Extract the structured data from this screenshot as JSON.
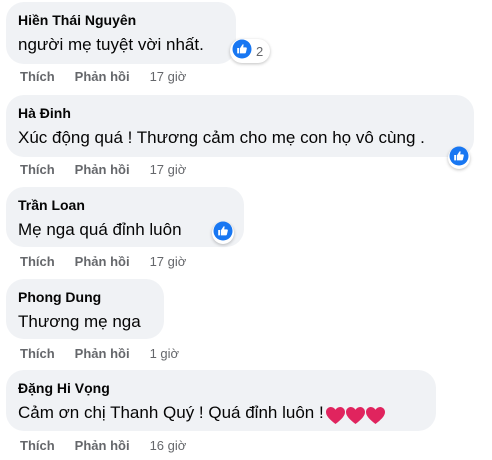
{
  "actions": {
    "like_label": "Thích",
    "reply_label": "Phản hồi"
  },
  "comments": [
    {
      "author": "Hiền Thái Nguyên",
      "text": "người mẹ tuyệt vời nhất.",
      "reaction": "like-icon",
      "reaction_count": "2",
      "time": "17 giờ"
    },
    {
      "author": "Hà Đinh",
      "text": "Xúc động quá ! Thương cảm cho mẹ con họ vô cùng .",
      "reaction": "like-icon",
      "time": "17 giờ"
    },
    {
      "author": "Trần Loan",
      "text": "Mẹ nga quá đỉnh luôn",
      "reaction": "like-icon",
      "time": "17 giờ"
    },
    {
      "author": "Phong Dung",
      "text": "Thương mẹ nga",
      "time": "1 giờ"
    },
    {
      "author": "Đặng Hi Vọng",
      "text": "Cảm ơn chị Thanh Quý ! Quá đỉnh luôn !",
      "emoji": [
        "heart-emoji",
        "heart-emoji",
        "heart-emoji"
      ],
      "time": "16 giờ"
    }
  ],
  "colors": {
    "bubble": "#f0f2f5",
    "secondary_text": "#65676b",
    "like_blue": "#1877f2",
    "heart_red": "#e0245e"
  }
}
